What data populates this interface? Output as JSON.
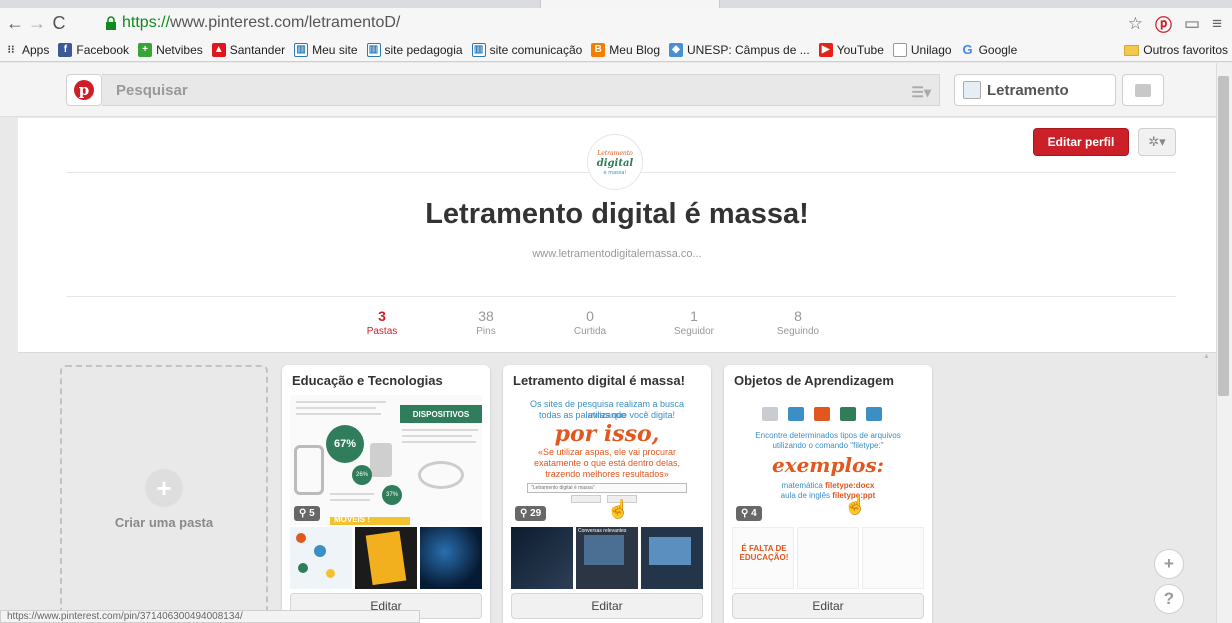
{
  "browser": {
    "url_https": "https://",
    "url_rest": "www.pinterest.com/letramentoD/",
    "bookmarks": [
      {
        "label": "Apps",
        "color": "#e34c26"
      },
      {
        "label": "Facebook",
        "color": "#3b5998"
      },
      {
        "label": "Netvibes",
        "color": "#3aa335"
      },
      {
        "label": "Santander",
        "color": "#e3141b"
      },
      {
        "label": "Meu site",
        "color": "#2b7bb9"
      },
      {
        "label": "site pedagogia",
        "color": "#2b7bb9"
      },
      {
        "label": "site comunicação",
        "color": "#2b7bb9"
      },
      {
        "label": "Meu Blog",
        "color": "#f57d00"
      },
      {
        "label": "UNESP: Câmpus de ...",
        "color": "#4a8fd6"
      },
      {
        "label": "YouTube",
        "color": "#e62117"
      },
      {
        "label": "Unilago",
        "color": "#999999"
      },
      {
        "label": "Google",
        "color": "#4285f4"
      }
    ],
    "other_bookmarks": "Outros favoritos",
    "status_url": "https://www.pinterest.com/pin/371406300494008134/"
  },
  "header": {
    "search_placeholder": "Pesquisar",
    "username": "Letramento"
  },
  "profile": {
    "edit_label": "Editar perfil",
    "logo_text_1": "Letramento",
    "logo_text_2": "digital",
    "logo_text_3": "é massa!",
    "title": "Letramento digital é massa!",
    "website": "www.letramentodigitalemassa.co...",
    "stats": [
      {
        "n": "3",
        "label": "Pastas"
      },
      {
        "n": "38",
        "label": "Pins"
      },
      {
        "n": "0",
        "label": "Curtida"
      },
      {
        "n": "1",
        "label": "Seguidor"
      },
      {
        "n": "8",
        "label": "Seguindo"
      }
    ]
  },
  "create_board": {
    "label": "Criar uma pasta"
  },
  "boards": [
    {
      "title": "Educação e Tecnologias",
      "pin_count": "5",
      "edit": "Editar",
      "cover": {
        "band": "DISPOSITIVOS",
        "pct_big": "67%",
        "pct_small_1": "26%",
        "pct_small_2": "37%",
        "footer": "MÓVEIS !"
      }
    },
    {
      "title": "Letramento digital é massa!",
      "pin_count": "29",
      "edit": "Editar",
      "cover": {
        "line1": "Os sites de pesquisa realizam a busca utilizando",
        "line2": "todas as palavras que você digita!",
        "big": "por isso,",
        "line3": "«Se utilizar aspas, ele vai procurar",
        "line4": "exatamente o que está dentro delas,",
        "line5": "trazendo melhores resultados»",
        "search_text": "\"Letramento digital é massa\""
      },
      "thumb_text": "Conversas relevantes"
    },
    {
      "title": "Objetos de Aprendizagem",
      "pin_count": "4",
      "edit": "Editar",
      "cover": {
        "line1": "Encontre determinados tipos de arquivos",
        "line2": "utilizando o comando \"filetype:\"",
        "big": "exemplos:",
        "ex1_a": "matemática ",
        "ex1_b": "filetype:docx",
        "ex2_a": "aula de inglês ",
        "ex2_b": "filetype:ppt"
      },
      "thumb_text": "É FALTA DE EDUCAÇÃO!"
    }
  ],
  "colors": {
    "brand": "#cb2027",
    "cover_blue": "#3b8fc4",
    "cover_orange": "#e2571e"
  }
}
